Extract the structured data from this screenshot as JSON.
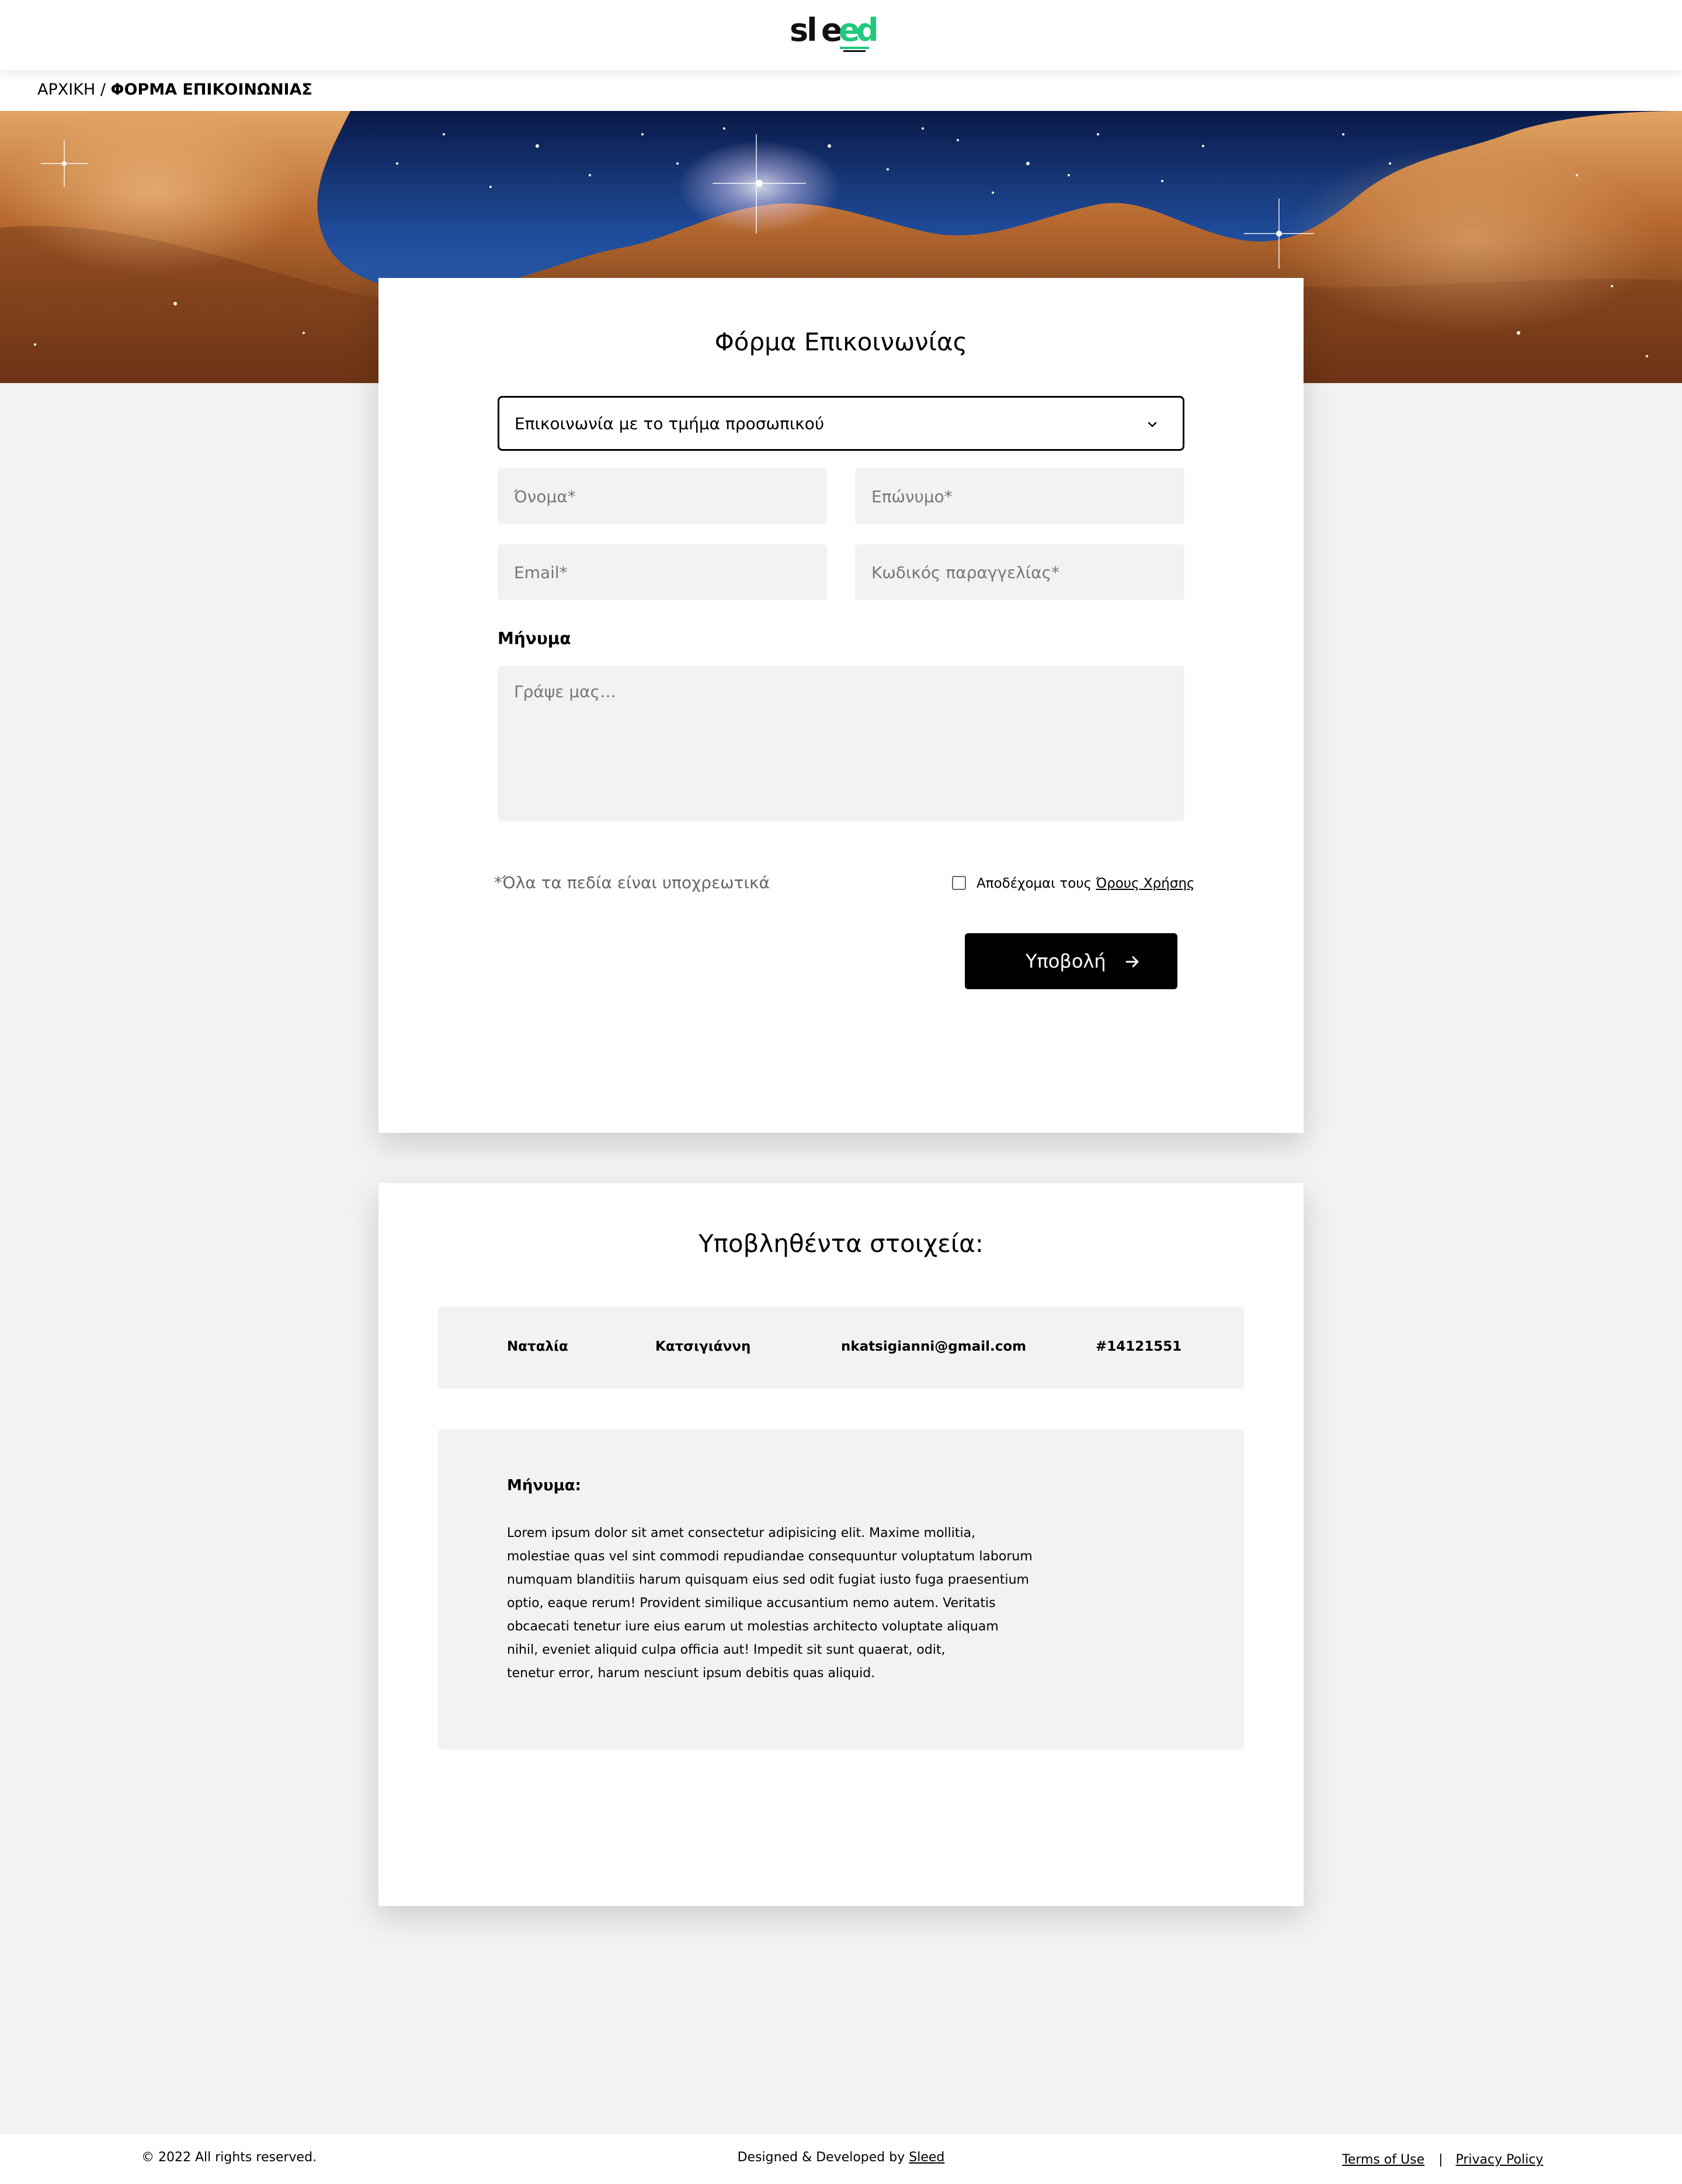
{
  "brand": {
    "logo_text": "sleed",
    "accent": "#1fc97d"
  },
  "breadcrumb": {
    "home": "ΑΡΧΙΚΗ",
    "separator": "/",
    "current": "ΦΟΡΜΑ ΕΠΙΚΟΙΝΩΝΙΑΣ"
  },
  "form": {
    "title": "Φόρμα Επικοινωνίας",
    "department_select": {
      "value": "Επικοινωνία με το τμήμα προσωπικού",
      "icon": "chevron-down-icon"
    },
    "first_name_placeholder": "Όνομα*",
    "last_name_placeholder": "Επώνυμο*",
    "email_placeholder": "Email*",
    "order_code_placeholder": "Κωδικός παραγγελίας*",
    "message_label": "Μήνυμα",
    "message_placeholder": "Γράψε μας…",
    "required_note": "*Όλα τα πεδία είναι υποχρεωτικά",
    "terms_prefix": "Αποδέχομαι τους ",
    "terms_link": "Όρους Χρήσης",
    "terms_checked": false,
    "submit_label": "Υποβολή",
    "submit_icon": "arrow-right-icon"
  },
  "submitted": {
    "title": "Υποβληθέντα στοιχεία:",
    "first_name": "Ναταλία",
    "last_name": "Κατσιγιάννη",
    "email": "nkatsigianni@gmail.com",
    "order_code": "#14121551",
    "message_label": "Μήνυμα:",
    "message_text": "Lorem ipsum dolor sit amet consectetur adipisicing elit. Maxime mollitia,\nmolestiae quas vel sint commodi repudiandae consequuntur voluptatum laborum\nnumquam blanditiis harum quisquam eius sed odit fugiat iusto fuga praesentium\noptio, eaque rerum! Provident similique accusantium nemo autem. Veritatis\nobcaecati tenetur iure eius earum ut molestias architecto voluptate aliquam\nnihil, eveniet aliquid culpa officia aut! Impedit sit sunt quaerat, odit,\ntenetur error, harum nesciunt ipsum debitis quas aliquid."
  },
  "footer": {
    "copyright": "© 2022 All rights reserved.",
    "credit_prefix": "Designed & Developed by ",
    "credit_link": "Sleed",
    "terms_link": "Terms of Use",
    "separator": "|",
    "privacy_link": "Privacy Policy"
  }
}
